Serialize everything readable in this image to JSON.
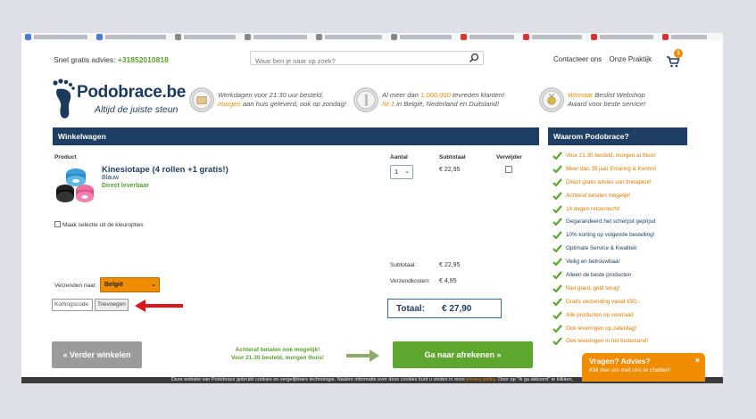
{
  "header": {
    "advice_prefix": "Snel gratis advies:",
    "phone": "+31852010818",
    "search_placeholder": "Waar ben je naar op zoek?",
    "links": [
      "Contacteer ons",
      "Onze Praktijk"
    ],
    "cart_count": "1"
  },
  "brand": {
    "name": "Podobrace.be",
    "tagline": "Altijd de juiste steun"
  },
  "usps": [
    {
      "line1": "Werkdagen voor 21:30 uur besteld,",
      "line2_highlight": "morgen",
      "line2_rest": " aan huis geleverd, ook op zondag!"
    },
    {
      "line1_prefix": "Al meer dan ",
      "line1_highlight": "1.000.000",
      "line1_suffix": " tevreden klanten!",
      "line2_highlight": "Nr.1",
      "line2_rest": " in België, Nederland en Duitsland!"
    },
    {
      "line1_highlight": "Winnaar",
      "line1_rest": " Beslist Webshop",
      "line2": "Award voor beste service!"
    }
  ],
  "cart": {
    "title": "Winkelwagen",
    "columns": {
      "product": "Product",
      "quantity": "Aantal",
      "subtotal": "Subtotaal",
      "remove": "Verwijder"
    },
    "item": {
      "name": "Kinesiotape (4 rollen +1 gratis!)",
      "color": "Blauw",
      "stock": "Direct leverbaar",
      "quantity": "1",
      "subtotal": "€ 22,95"
    },
    "colour_option": "Maak selectie uit de kleuropties",
    "summary": {
      "subtotal_label": "Subtotaal:",
      "subtotal_value": "€ 22,95",
      "shipping_label": "Verzendkosten:",
      "shipping_value": "€ 4,95",
      "total_label": "Totaal:",
      "total_value": "€ 27,90"
    },
    "ship_to_label": "Verzenden naar:",
    "ship_to_value": "België",
    "coupon_placeholder": "Kortingscode",
    "coupon_button": "Toevoegen",
    "continue_button": "« Verder winkelen",
    "promo_line1": "Achteraf betalen ook mogelijk!",
    "promo_line2": "Voor 21.30 besteld, morgen thuis!",
    "checkout_button": "Ga naar afrekenen »"
  },
  "why": {
    "title": "Waarom Podobrace?",
    "items": [
      {
        "text": "Voor 21:30 besteld, morgen al thuis!",
        "color": "#e07b00"
      },
      {
        "text": "Meer dan 35 jaar Ervaring & Kennis!",
        "color": "#e07b00"
      },
      {
        "text": "Direct gratis advies van therapeut!",
        "color": "#e07b00"
      },
      {
        "text": "Achteraf betalen mogelijk!",
        "color": "#e07b00"
      },
      {
        "text": "14 dagen retourrecht!",
        "color": "#e07b00"
      },
      {
        "text": "Gegarandeerd het scherpst geprijsd",
        "color": "#1f3e63"
      },
      {
        "text": "10% korting op volgende bestelling!",
        "color": "#1f3e63"
      },
      {
        "text": "Optimale Service & Kwaliteit",
        "color": "#1f3e63"
      },
      {
        "text": "Veilig en betrouwbaar",
        "color": "#1f3e63"
      },
      {
        "text": "Alleen de beste producten",
        "color": "#1f3e63"
      },
      {
        "text": "Niet goed, geld terug!",
        "color": "#e07b00"
      },
      {
        "text": "Gratis verzending vanaf €50,-",
        "color": "#e07b00"
      },
      {
        "text": "Alle producten op voorraad",
        "color": "#e07b00"
      },
      {
        "text": "Ook leveringen op zaterdag!",
        "color": "#e07b00"
      },
      {
        "text": "Ook leveringen in het buitenland!",
        "color": "#e07b00"
      }
    ]
  },
  "cookie": {
    "text_before": "Deze website van Podobrace gebruikt cookies en vergelijkbare technologie. Nadere informatie over deze cookies kunt u vinden in onze ",
    "link": "privacy policy",
    "text_after": ". Door op \"Ik ga akkoord\" te klikken,"
  },
  "chat": {
    "title": "Vragen? Advies?",
    "subtitle": "Klik hier om met ons te chatten!",
    "close": "×"
  },
  "colors": {
    "navy": "#1f3e63",
    "green": "#5ea72e",
    "orange": "#f08c00",
    "red_arrow": "#e0141e"
  }
}
